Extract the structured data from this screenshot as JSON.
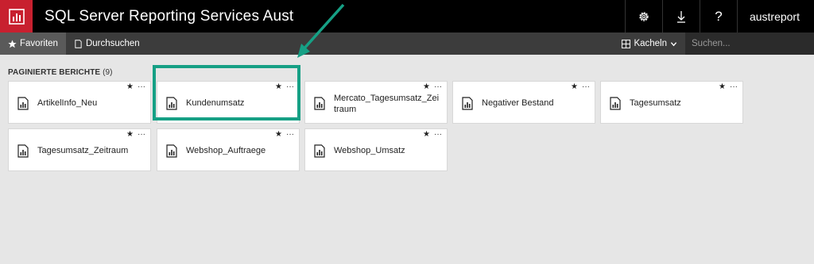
{
  "app": {
    "title": "SQL Server Reporting Services Aust",
    "user": "austreport"
  },
  "top_actions": [
    {
      "icon": "gear-icon"
    },
    {
      "icon": "download-icon"
    },
    {
      "icon": "help-icon",
      "glyph": "?"
    }
  ],
  "nav": {
    "favorites": "Favoriten",
    "browse": "Durchsuchen",
    "view": "Kacheln",
    "search_placeholder": "Suchen..."
  },
  "section": {
    "title": "PAGINIERTE BERICHTE",
    "count": "(9)"
  },
  "reports": [
    {
      "name": "ArtikelInfo_Neu"
    },
    {
      "name": "Kundenumsatz"
    },
    {
      "name": "Mercato_Tagesumsatz_Zeitraum"
    },
    {
      "name": "Negativer Bestand"
    },
    {
      "name": "Tagesumsatz"
    },
    {
      "name": "Tagesumsatz_Zeitraum"
    },
    {
      "name": "Webshop_Auftraege"
    },
    {
      "name": "Webshop_Umsatz"
    }
  ],
  "tile_actions": {
    "star": "★",
    "more": "···"
  },
  "colors": {
    "brand": "#c8202f",
    "highlight": "#16a085",
    "topbar": "#000000",
    "navbar": "#3c3c3c"
  }
}
